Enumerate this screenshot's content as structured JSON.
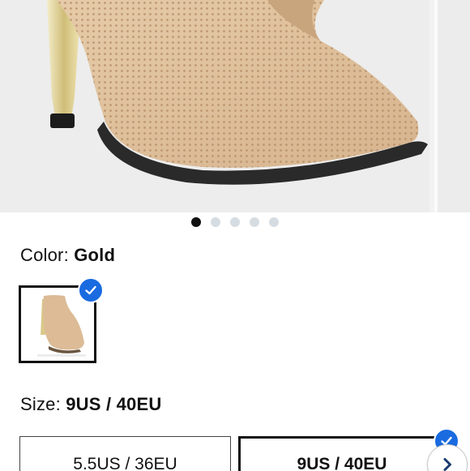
{
  "carousel": {
    "slide_count": 5,
    "active_index": 0
  },
  "color": {
    "label": "Color:",
    "value": "Gold"
  },
  "size": {
    "label": "Size:",
    "value": "9US / 40EU",
    "options": [
      {
        "label": "5.5US / 36EU",
        "selected": false
      },
      {
        "label": "9US / 40EU",
        "selected": true
      }
    ]
  },
  "colors": {
    "accent": "#1a6be0",
    "boot": "#dcbb96",
    "heel": "#d9c98a"
  },
  "icons": {
    "check": "check-icon",
    "next": "chevron-right-icon"
  }
}
